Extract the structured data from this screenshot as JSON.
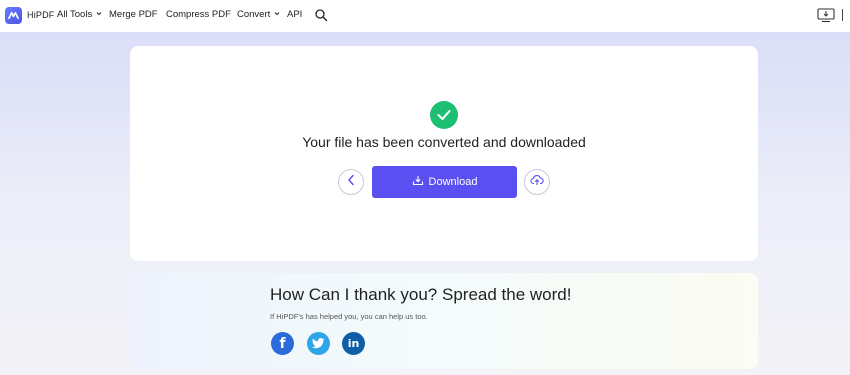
{
  "header": {
    "brand": "HiPDF",
    "nav": {
      "all_tools": "All Tools",
      "merge_pdf": "Merge PDF",
      "compress_pdf": "Compress PDF",
      "convert": "Convert",
      "api": "API"
    },
    "icons": [
      "hipdf-logo-icon",
      "chevron-down-icon",
      "search-icon",
      "desktop-download-icon"
    ]
  },
  "result": {
    "status_text": "Your file has been converted and downloaded",
    "download_label": "Download",
    "icons": [
      "check-circle-icon",
      "chevron-left-icon",
      "download-icon",
      "cloud-upload-icon"
    ]
  },
  "share": {
    "title": "How Can I thank you? Spread the word!",
    "subtitle": "If HiPDF's has helped you, you can help us too.",
    "facebook_glyph": "f",
    "linkedin_glyph": "in",
    "icons": [
      "facebook-icon",
      "twitter-icon",
      "linkedin-icon"
    ]
  },
  "colors": {
    "accent": "#5a4ff0",
    "success": "#1dbf73",
    "facebook": "#2b6ad9",
    "twitter": "#2ea5e6",
    "linkedin": "#0f5fa8"
  }
}
